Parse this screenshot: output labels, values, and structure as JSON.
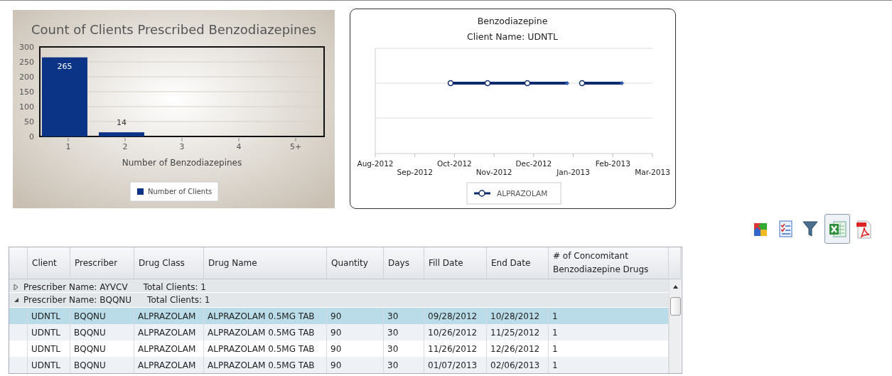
{
  "bar_chart": {
    "chart_data": {
      "type": "bar",
      "title": "Count of Clients Prescribed Benzodiazepines",
      "xlabel": "Number of Benzodiazepines",
      "categories": [
        "1",
        "2",
        "3",
        "4",
        "5+"
      ],
      "series": [
        {
          "name": "Number of Clients",
          "color": "#0b3487",
          "values": [
            265,
            14,
            0,
            0,
            0
          ]
        }
      ],
      "grid": true,
      "ylim": [
        0,
        300
      ],
      "yticks": [
        0,
        50,
        100,
        150,
        200,
        250,
        300
      ],
      "value_labels": [
        "265",
        "14",
        null,
        null,
        null
      ]
    }
  },
  "line_chart": {
    "title": "Benzodiazepine",
    "subtitle": "Client Name: UDNTL",
    "x_axis_labels": [
      "Aug-2012",
      "Sep-2012",
      "Oct-2012",
      "Nov-2012",
      "Dec-2012",
      "Jan-2013",
      "Feb-2013",
      "Mar-2013"
    ],
    "legend": [
      "ALPRAZOLAM"
    ]
  },
  "toolbar": [
    {
      "kind": "puzzle",
      "selected": false
    },
    {
      "kind": "checklist",
      "selected": false
    },
    {
      "kind": "filter",
      "selected": false
    },
    {
      "kind": "spreadsheet",
      "selected": true
    },
    {
      "kind": "pdf",
      "selected": false
    }
  ],
  "table": {
    "columns": [
      "Client",
      "Prescriber",
      "Drug Class",
      "Drug Name",
      "Quantity",
      "Days",
      "Fill Date",
      "End Date",
      "# of Concomitant Benzodiazepine Drugs"
    ],
    "rows": [
      {
        "kind": "group",
        "label": "Prescriber Name:  AYVCV",
        "count": "Total Clients: 1",
        "expanded": false
      },
      {
        "kind": "group",
        "label": "Prescriber Name:  BQQNU",
        "count": "Total Clients: 1",
        "expanded": true
      },
      {
        "kind": "data",
        "selected": true,
        "cells": [
          "UDNTL",
          "BQQNU",
          "ALPRAZOLAM",
          "ALPRAZOLAM 0.5MG TAB",
          "90",
          "30",
          "09/28/2012",
          "10/28/2012",
          "1"
        ]
      },
      {
        "kind": "data",
        "selected": false,
        "cells": [
          "UDNTL",
          "BQQNU",
          "ALPRAZOLAM",
          "ALPRAZOLAM 0.5MG TAB",
          "90",
          "30",
          "10/26/2012",
          "11/25/2012",
          "1"
        ]
      },
      {
        "kind": "data",
        "selected": false,
        "cells": [
          "UDNTL",
          "BQQNU",
          "ALPRAZOLAM",
          "ALPRAZOLAM 0.5MG TAB",
          "90",
          "30",
          "11/26/2012",
          "12/26/2012",
          "1"
        ]
      },
      {
        "kind": "data",
        "selected": false,
        "cells": [
          "UDNTL",
          "BQQNU",
          "ALPRAZOLAM",
          "ALPRAZOLAM 0.5MG TAB",
          "90",
          "30",
          "01/07/2013",
          "02/06/2013",
          "1"
        ]
      }
    ]
  }
}
